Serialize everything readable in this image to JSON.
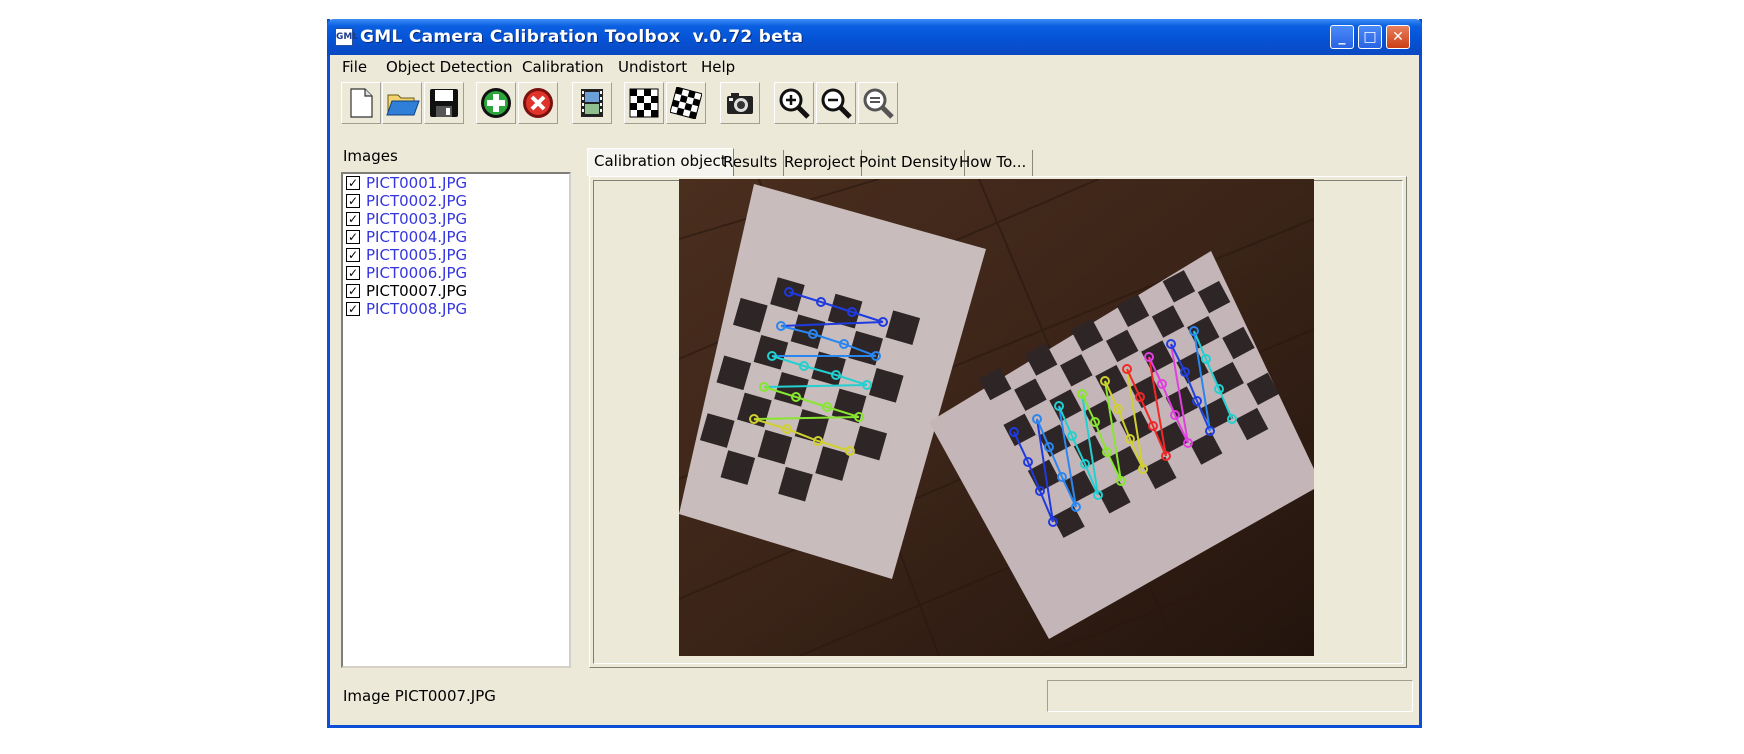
{
  "window": {
    "title": "GML Camera Calibration Toolbox  v.0.72 beta",
    "title_colors": {
      "bar": "#0553d6",
      "text": "#ffffff"
    },
    "controls": [
      "minimize",
      "maximize",
      "close"
    ]
  },
  "menu": [
    "File",
    "Object Detection",
    "Calibration",
    "Undistort",
    "Help"
  ],
  "toolbar": [
    {
      "icon": "new-file-icon"
    },
    {
      "icon": "open-folder-icon"
    },
    {
      "icon": "save-icon"
    },
    {
      "icon": "add-image-icon"
    },
    {
      "icon": "remove-image-icon"
    },
    {
      "icon": "film-strip-icon"
    },
    {
      "icon": "checkerboard-icon"
    },
    {
      "icon": "checkerboard-detect-icon"
    },
    {
      "icon": "camera-icon"
    },
    {
      "icon": "zoom-in-icon"
    },
    {
      "icon": "zoom-out-icon"
    },
    {
      "icon": "zoom-fit-icon"
    }
  ],
  "images_panel": {
    "label": "Images",
    "items": [
      {
        "name": "PICT0001.JPG",
        "checked": true,
        "selected": false
      },
      {
        "name": "PICT0002.JPG",
        "checked": true,
        "selected": false
      },
      {
        "name": "PICT0003.JPG",
        "checked": true,
        "selected": false
      },
      {
        "name": "PICT0004.JPG",
        "checked": true,
        "selected": false
      },
      {
        "name": "PICT0005.JPG",
        "checked": true,
        "selected": false
      },
      {
        "name": "PICT0006.JPG",
        "checked": true,
        "selected": false
      },
      {
        "name": "PICT0007.JPG",
        "checked": true,
        "selected": true
      },
      {
        "name": "PICT0008.JPG",
        "checked": true,
        "selected": false
      }
    ]
  },
  "tabs": [
    "Calibration object",
    "Results",
    "Reproject",
    "Point Density",
    "How To..."
  ],
  "active_tab": "Calibration object",
  "status": {
    "text": "Image PICT0007.JPG"
  }
}
